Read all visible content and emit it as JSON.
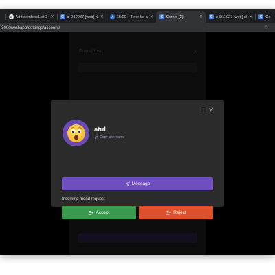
{
  "browser": {
    "tabs": [
      {
        "label": "",
        "icon": "chrome-icon"
      },
      {
        "label": "AddMembersListC",
        "icon": "github-icon"
      },
      {
        "label": "D10937 [web] N",
        "icon": "c-app-icon"
      },
      {
        "label": "15:00 – Time for a t",
        "icon": "check-icon"
      },
      {
        "label": "Comm (3)",
        "icon": "c-app-icon"
      },
      {
        "label": "D11027 [web] ch",
        "icon": "c-app-icon"
      },
      {
        "label": "Co",
        "icon": "c-app-icon"
      }
    ],
    "url": "3000/webapp/settings/account/"
  },
  "background": {
    "title": "Friend List",
    "add_button": "Add New Friends"
  },
  "modal": {
    "username": "atul",
    "copy_label": "Copy username",
    "message_label": "Message",
    "request_label": "Incoming friend request",
    "accept_label": "Accept",
    "reject_label": "Reject",
    "avatar_emoji": "😲"
  },
  "colors": {
    "modal_bg": "#2b2b2b",
    "message": "#6e4fc0",
    "accept": "#379a4c",
    "reject": "#e0502a",
    "avatar": "#6b4ab3"
  }
}
